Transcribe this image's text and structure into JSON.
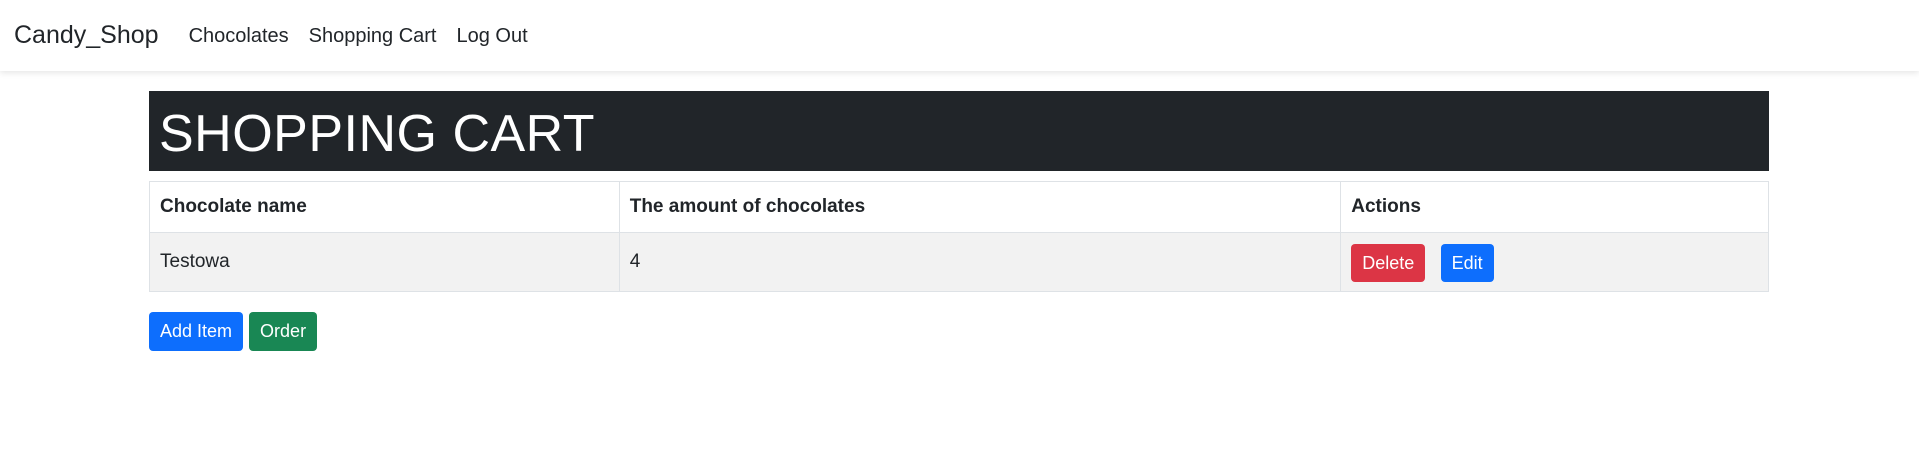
{
  "navbar": {
    "brand": "Candy_Shop",
    "links": [
      "Chocolates",
      "Shopping Cart",
      "Log Out"
    ]
  },
  "page_title": "SHOPPING CART",
  "table": {
    "headers": [
      "Chocolate name",
      "The amount of chocolates",
      "Actions"
    ],
    "rows": [
      {
        "name": "Testowa",
        "amount": "4",
        "delete_label": "Delete",
        "edit_label": "Edit"
      }
    ]
  },
  "buttons": {
    "add_item": "Add Item",
    "order": "Order"
  },
  "colors": {
    "navbar_bg": "#ffffff",
    "title_bg": "#212529",
    "danger": "#dc3545",
    "primary": "#0d6efd",
    "success": "#198754",
    "row_bg": "#f2f2f2"
  }
}
